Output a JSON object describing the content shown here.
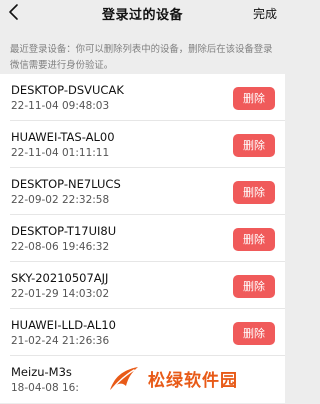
{
  "header": {
    "title": "登录过的设备",
    "done_label": "完成",
    "back_icon": "chevron-left-icon"
  },
  "notice": "最近登录设备：你可以删除列表中的设备，删除后在该设备登录微信需要进行身份验证。",
  "devices": [
    {
      "name": "DESKTOP-DSVUCAK",
      "time": "22-11-04 09:48:03",
      "delete_label": "删除"
    },
    {
      "name": "HUAWEI-TAS-AL00",
      "time": "22-11-04 01:11:11",
      "delete_label": "删除"
    },
    {
      "name": "DESKTOP-NE7LUCS",
      "time": "22-09-02 22:32:58",
      "delete_label": "删除"
    },
    {
      "name": "DESKTOP-T17UI8U",
      "time": "22-08-06 19:46:32",
      "delete_label": "删除"
    },
    {
      "name": "SKY-20210507AJJ",
      "time": "22-01-29 14:03:02",
      "delete_label": "删除"
    },
    {
      "name": "HUAWEI-LLD-AL10",
      "time": "21-02-24 21:26:36",
      "delete_label": "删除"
    },
    {
      "name": "Meizu-M3s",
      "time": "18-04-08 16:"
    }
  ],
  "watermark": {
    "text": "松绿软件园"
  },
  "colors": {
    "background": "#ededed",
    "delete_button": "#f05a5a",
    "watermark": "#e85a17"
  }
}
